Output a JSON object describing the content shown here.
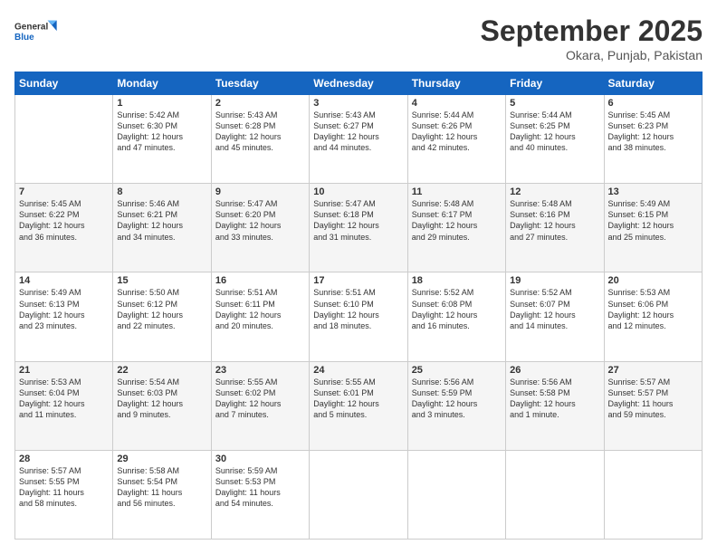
{
  "header": {
    "logo": {
      "general": "General",
      "blue": "Blue"
    },
    "title": "September 2025",
    "location": "Okara, Punjab, Pakistan"
  },
  "days": [
    "Sunday",
    "Monday",
    "Tuesday",
    "Wednesday",
    "Thursday",
    "Friday",
    "Saturday"
  ],
  "weeks": [
    [
      {
        "day": "",
        "info": ""
      },
      {
        "day": "1",
        "info": "Sunrise: 5:42 AM\nSunset: 6:30 PM\nDaylight: 12 hours\nand 47 minutes."
      },
      {
        "day": "2",
        "info": "Sunrise: 5:43 AM\nSunset: 6:28 PM\nDaylight: 12 hours\nand 45 minutes."
      },
      {
        "day": "3",
        "info": "Sunrise: 5:43 AM\nSunset: 6:27 PM\nDaylight: 12 hours\nand 44 minutes."
      },
      {
        "day": "4",
        "info": "Sunrise: 5:44 AM\nSunset: 6:26 PM\nDaylight: 12 hours\nand 42 minutes."
      },
      {
        "day": "5",
        "info": "Sunrise: 5:44 AM\nSunset: 6:25 PM\nDaylight: 12 hours\nand 40 minutes."
      },
      {
        "day": "6",
        "info": "Sunrise: 5:45 AM\nSunset: 6:23 PM\nDaylight: 12 hours\nand 38 minutes."
      }
    ],
    [
      {
        "day": "7",
        "info": "Sunrise: 5:45 AM\nSunset: 6:22 PM\nDaylight: 12 hours\nand 36 minutes."
      },
      {
        "day": "8",
        "info": "Sunrise: 5:46 AM\nSunset: 6:21 PM\nDaylight: 12 hours\nand 34 minutes."
      },
      {
        "day": "9",
        "info": "Sunrise: 5:47 AM\nSunset: 6:20 PM\nDaylight: 12 hours\nand 33 minutes."
      },
      {
        "day": "10",
        "info": "Sunrise: 5:47 AM\nSunset: 6:18 PM\nDaylight: 12 hours\nand 31 minutes."
      },
      {
        "day": "11",
        "info": "Sunrise: 5:48 AM\nSunset: 6:17 PM\nDaylight: 12 hours\nand 29 minutes."
      },
      {
        "day": "12",
        "info": "Sunrise: 5:48 AM\nSunset: 6:16 PM\nDaylight: 12 hours\nand 27 minutes."
      },
      {
        "day": "13",
        "info": "Sunrise: 5:49 AM\nSunset: 6:15 PM\nDaylight: 12 hours\nand 25 minutes."
      }
    ],
    [
      {
        "day": "14",
        "info": "Sunrise: 5:49 AM\nSunset: 6:13 PM\nDaylight: 12 hours\nand 23 minutes."
      },
      {
        "day": "15",
        "info": "Sunrise: 5:50 AM\nSunset: 6:12 PM\nDaylight: 12 hours\nand 22 minutes."
      },
      {
        "day": "16",
        "info": "Sunrise: 5:51 AM\nSunset: 6:11 PM\nDaylight: 12 hours\nand 20 minutes."
      },
      {
        "day": "17",
        "info": "Sunrise: 5:51 AM\nSunset: 6:10 PM\nDaylight: 12 hours\nand 18 minutes."
      },
      {
        "day": "18",
        "info": "Sunrise: 5:52 AM\nSunset: 6:08 PM\nDaylight: 12 hours\nand 16 minutes."
      },
      {
        "day": "19",
        "info": "Sunrise: 5:52 AM\nSunset: 6:07 PM\nDaylight: 12 hours\nand 14 minutes."
      },
      {
        "day": "20",
        "info": "Sunrise: 5:53 AM\nSunset: 6:06 PM\nDaylight: 12 hours\nand 12 minutes."
      }
    ],
    [
      {
        "day": "21",
        "info": "Sunrise: 5:53 AM\nSunset: 6:04 PM\nDaylight: 12 hours\nand 11 minutes."
      },
      {
        "day": "22",
        "info": "Sunrise: 5:54 AM\nSunset: 6:03 PM\nDaylight: 12 hours\nand 9 minutes."
      },
      {
        "day": "23",
        "info": "Sunrise: 5:55 AM\nSunset: 6:02 PM\nDaylight: 12 hours\nand 7 minutes."
      },
      {
        "day": "24",
        "info": "Sunrise: 5:55 AM\nSunset: 6:01 PM\nDaylight: 12 hours\nand 5 minutes."
      },
      {
        "day": "25",
        "info": "Sunrise: 5:56 AM\nSunset: 5:59 PM\nDaylight: 12 hours\nand 3 minutes."
      },
      {
        "day": "26",
        "info": "Sunrise: 5:56 AM\nSunset: 5:58 PM\nDaylight: 12 hours\nand 1 minute."
      },
      {
        "day": "27",
        "info": "Sunrise: 5:57 AM\nSunset: 5:57 PM\nDaylight: 11 hours\nand 59 minutes."
      }
    ],
    [
      {
        "day": "28",
        "info": "Sunrise: 5:57 AM\nSunset: 5:55 PM\nDaylight: 11 hours\nand 58 minutes."
      },
      {
        "day": "29",
        "info": "Sunrise: 5:58 AM\nSunset: 5:54 PM\nDaylight: 11 hours\nand 56 minutes."
      },
      {
        "day": "30",
        "info": "Sunrise: 5:59 AM\nSunset: 5:53 PM\nDaylight: 11 hours\nand 54 minutes."
      },
      {
        "day": "",
        "info": ""
      },
      {
        "day": "",
        "info": ""
      },
      {
        "day": "",
        "info": ""
      },
      {
        "day": "",
        "info": ""
      }
    ]
  ]
}
